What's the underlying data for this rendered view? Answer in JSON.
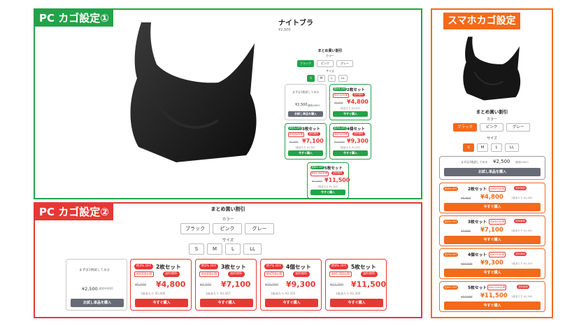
{
  "colors": {
    "green": "#22a34a",
    "red": "#e53935",
    "orange": "#f26a1b",
    "gray_button": "#666b75"
  },
  "panel1": {
    "tag": "PC カゴ設定①",
    "product_title": "ナイトブラ",
    "product_price": "¥2,500",
    "heading": "まとめ買い割引",
    "color_label": "カラー",
    "colors": [
      "ブラック",
      "ピンク",
      "グレー"
    ],
    "size_label": "サイズ",
    "sizes": [
      "S",
      "M",
      "L",
      "LL"
    ],
    "trial": {
      "caption": "まずは1枚試してみる",
      "price": "¥2,500",
      "old": "通常¥4800",
      "button": "お試し単品を購入"
    },
    "offers": [
      {
        "badge": "約4% OFF",
        "title": "2枚セット",
        "note": "約¥200お得",
        "free": "送料無料",
        "old": "¥5,000",
        "new": "¥4,800",
        "per": "1枚あたり ¥2,400",
        "button": "今すぐ購入"
      },
      {
        "badge": "約5% OFF",
        "title": "3枚セット",
        "note": "約¥400お得",
        "free": "送料無料",
        "old": "¥7,500",
        "new": "¥7,100",
        "per": "1枚あたり ¥2,367",
        "button": "今すぐ購入"
      },
      {
        "badge": "約7% OFF",
        "title": "4個セット",
        "note": "約¥700お得",
        "free": "送料無料",
        "old": "¥10,000",
        "new": "¥9,300",
        "per": "1枚あたり ¥2,325",
        "button": "今すぐ購入"
      },
      {
        "badge": "約8% OFF",
        "title": "5枚セット",
        "note": "約¥1,000お得",
        "free": "送料無料",
        "old": "¥12,500",
        "new": "¥11,500",
        "per": "1枚あたり ¥2,300",
        "button": "今すぐ購入"
      }
    ]
  },
  "panel2": {
    "tag": "PC カゴ設定②",
    "heading": "まとめ買い割引",
    "color_label": "カラー",
    "colors": [
      "ブラック",
      "ピンク",
      "グレー"
    ],
    "size_label": "サイズ",
    "sizes": [
      "S",
      "M",
      "L",
      "LL"
    ],
    "trial": {
      "caption": "まずは1枚試してみる",
      "price": "¥2,500",
      "old": "通常¥4800",
      "button": "お試し単品を購入"
    },
    "offers": [
      {
        "badge": "約4% OFF",
        "title": "2枚セット",
        "note": "約¥200お得",
        "free": "送料無料",
        "old": "¥5,000",
        "new": "¥4,800",
        "per": "1枚あたり ¥2,400",
        "button": "今すぐ購入"
      },
      {
        "badge": "約5% OFF",
        "title": "3枚セット",
        "note": "約¥400お得",
        "free": "送料無料",
        "old": "¥7,500",
        "new": "¥7,100",
        "per": "1枚あたり ¥2,367",
        "button": "今すぐ購入"
      },
      {
        "badge": "約7% OFF",
        "title": "4個セット",
        "note": "約¥700お得",
        "free": "送料無料",
        "old": "¥10,000",
        "new": "¥9,300",
        "per": "1枚あたり ¥2,325",
        "button": "今すぐ購入"
      },
      {
        "badge": "約8% OFF",
        "title": "5枚セット",
        "note": "約¥1,000お得",
        "free": "送料無料",
        "old": "¥12,500",
        "new": "¥11,500",
        "per": "1枚あたり ¥2,300",
        "button": "今すぐ購入"
      }
    ]
  },
  "panel3": {
    "tag": "スマホカゴ設定",
    "heading": "まとめ買い割引",
    "color_label": "カラー",
    "colors": [
      "ブラック",
      "ピンク",
      "グレー"
    ],
    "size_label": "サイズ",
    "sizes": [
      "S",
      "M",
      "L",
      "LL"
    ],
    "trial": {
      "caption": "まずは1枚試してみる",
      "price": "¥2,500",
      "old": "通常¥4800",
      "button": "お試し単品を購入"
    },
    "offers": [
      {
        "badge": "約4% OFF",
        "title": "2枚セット",
        "note": "約¥200お得",
        "free": "送料無料",
        "old": "¥5,000",
        "new": "¥4,800",
        "per": "1枚あたり ¥2,400",
        "button": "今すぐ購入"
      },
      {
        "badge": "約5% OFF",
        "title": "3枚セット",
        "note": "約¥400お得",
        "free": "送料無料",
        "old": "¥7,500",
        "new": "¥7,100",
        "per": "1枚あたり ¥2,367",
        "button": "今すぐ購入"
      },
      {
        "badge": "約7% OFF",
        "title": "4個セット",
        "note": "約¥700お得",
        "free": "送料無料",
        "old": "¥10,000",
        "new": "¥9,300",
        "per": "1枚あたり ¥2,325",
        "button": "今すぐ購入"
      },
      {
        "badge": "約8% OFF",
        "title": "5枚セット",
        "note": "約¥1,000お得",
        "free": "送料無料",
        "old": "¥12,500",
        "new": "¥11,500",
        "per": "1枚あたり ¥2,300",
        "button": "今すぐ購入"
      }
    ]
  }
}
